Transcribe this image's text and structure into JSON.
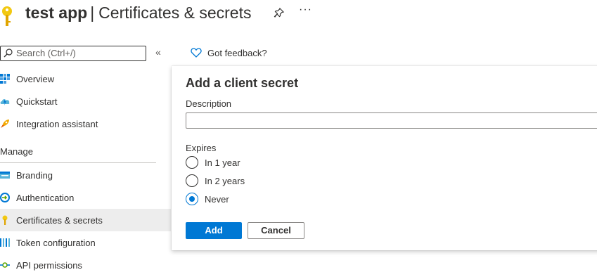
{
  "header": {
    "app_name": "test app",
    "separator": "|",
    "page_title": "Certificates & secrets",
    "more_label": "···"
  },
  "search": {
    "placeholder": "Search (Ctrl+/)",
    "collapse_glyph": "«"
  },
  "feedback": {
    "label": "Got feedback?"
  },
  "sidebar": {
    "items_top": [
      {
        "label": "Overview",
        "icon": "overview-grid-icon"
      },
      {
        "label": "Quickstart",
        "icon": "quickstart-cloud-icon"
      },
      {
        "label": "Integration assistant",
        "icon": "rocket-icon"
      }
    ],
    "section_title": "Manage",
    "items_manage": [
      {
        "label": "Branding",
        "icon": "branding-icon"
      },
      {
        "label": "Authentication",
        "icon": "authentication-icon"
      },
      {
        "label": "Certificates & secrets",
        "icon": "key-icon",
        "active": true
      },
      {
        "label": "Token configuration",
        "icon": "token-bars-icon"
      },
      {
        "label": "API permissions",
        "icon": "api-permissions-icon"
      }
    ]
  },
  "dialog": {
    "title": "Add a client secret",
    "description_label": "Description",
    "description_value": "",
    "expires_label": "Expires",
    "options": [
      {
        "label": "In 1 year",
        "selected": false
      },
      {
        "label": "In 2 years",
        "selected": false
      },
      {
        "label": "Never",
        "selected": true
      }
    ],
    "add_label": "Add",
    "cancel_label": "Cancel"
  },
  "colors": {
    "accent": "#0078d4",
    "text": "#323130",
    "active_bg": "#ededed",
    "key_gold": "#f2c811"
  }
}
